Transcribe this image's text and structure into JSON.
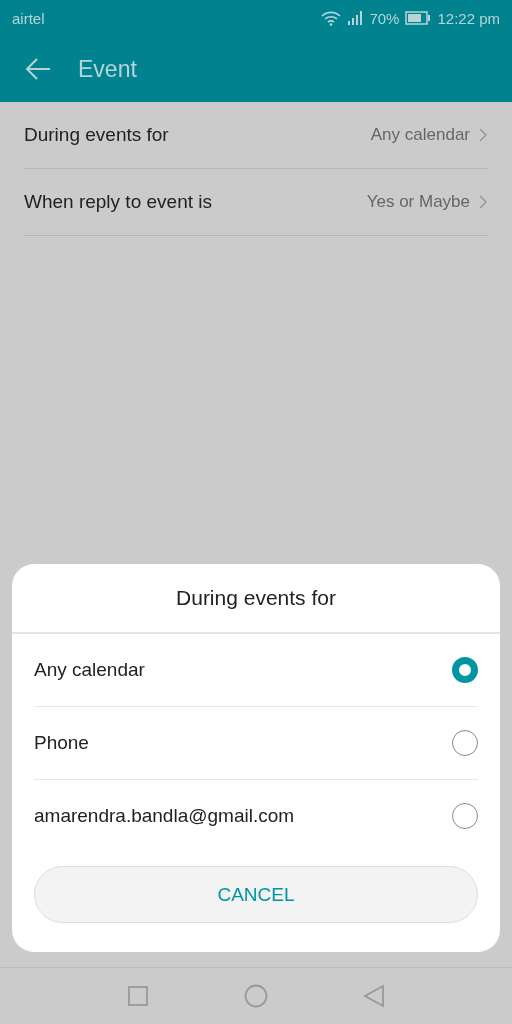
{
  "status_bar": {
    "carrier": "airtel",
    "battery": "70%",
    "time": "12:22 pm"
  },
  "app_bar": {
    "title": "Event"
  },
  "settings": [
    {
      "label": "During events for",
      "value": "Any calendar"
    },
    {
      "label": "When reply to event is",
      "value": "Yes or Maybe"
    }
  ],
  "dialog": {
    "title": "During events for",
    "options": [
      {
        "label": "Any calendar",
        "selected": true
      },
      {
        "label": "Phone",
        "selected": false
      },
      {
        "label": "amarendra.bandla@gmail.com",
        "selected": false
      }
    ],
    "cancel": "CANCEL"
  }
}
